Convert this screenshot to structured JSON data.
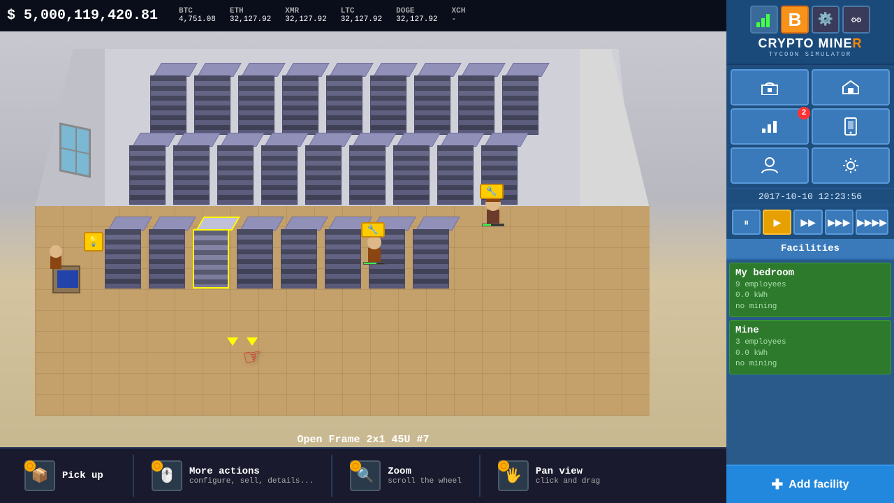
{
  "topbar": {
    "balance": "$ 5,000,119,420.81",
    "cryptos": [
      {
        "name": "BTC",
        "value": "4,751.08"
      },
      {
        "name": "ETH",
        "value": "32,127.92"
      },
      {
        "name": "XMR",
        "value": "32,127.92"
      },
      {
        "name": "LTC",
        "value": "32,127.92"
      },
      {
        "name": "DOGE",
        "value": "32,127.92"
      },
      {
        "name": "XCH",
        "value": "-"
      }
    ]
  },
  "logo": {
    "title": "Crypto MineR",
    "subtitle": "Tycoon Simulator"
  },
  "datetime": "2017-10-10  12:23:56",
  "facilities_header": "Facilities",
  "facilities": [
    {
      "name": "My bedroom",
      "employees": "9 employees",
      "kwh": "0.0 kWh",
      "mining": "no mining"
    },
    {
      "name": "Mine",
      "employees": "3 employees",
      "kwh": "0.0 kWh",
      "mining": "no mining"
    }
  ],
  "speed_buttons": [
    "⏸",
    "▶",
    "⏩",
    "⏩⏩",
    "⏩⏩⏩"
  ],
  "selected_item": "Open Frame 2x1 45U #7",
  "actions": [
    {
      "title": "Pick up",
      "desc": "",
      "icon": "📦"
    },
    {
      "title": "More actions",
      "desc": "configure, sell, details...",
      "icon": "🖱️"
    },
    {
      "title": "Zoom",
      "desc": "scroll the wheel",
      "icon": "🔍"
    },
    {
      "title": "Pan view",
      "desc": "click and drag",
      "icon": "🖐️"
    }
  ],
  "add_facility_label": "Add facility",
  "notification_count": "2",
  "nav_buttons": [
    {
      "icon": "🛒",
      "label": "shop"
    },
    {
      "icon": "🏠",
      "label": "facility"
    },
    {
      "icon": "📊",
      "label": "stats",
      "badge": "2"
    },
    {
      "icon": "📱",
      "label": "mobile"
    },
    {
      "icon": "👤",
      "label": "employee"
    },
    {
      "icon": "⚙️",
      "label": "settings"
    }
  ]
}
